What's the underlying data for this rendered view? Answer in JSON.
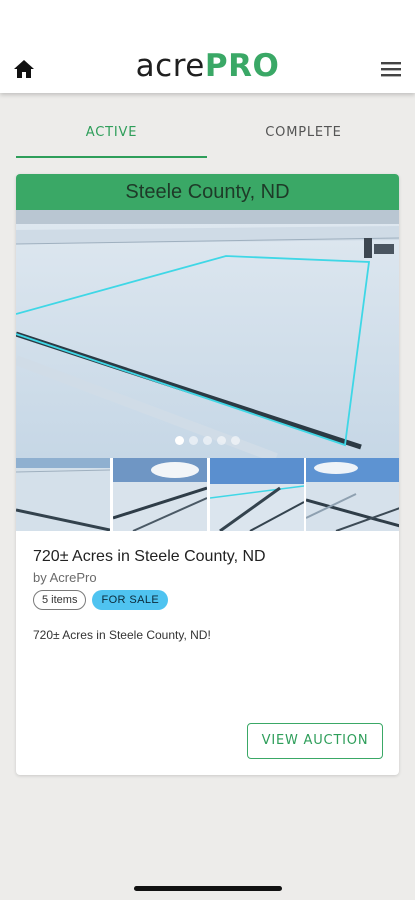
{
  "app": {
    "logo_part1": "acre",
    "logo_part2": "PRO",
    "accent_color": "#3aa866"
  },
  "nav": {
    "home_icon": "home-icon",
    "menu_icon": "hamburger-menu-icon"
  },
  "tabs": [
    {
      "label": "ACTIVE",
      "selected": true
    },
    {
      "label": "COMPLETE",
      "selected": false
    }
  ],
  "listing": {
    "header": "Steele County, ND",
    "title": "720± Acres in Steele County, ND",
    "byline": "by AcrePro",
    "items_chip": "5 items",
    "status_chip": "FOR SALE",
    "description": "720± Acres in Steele County, ND!",
    "button_label": "VIEW AUCTION",
    "carousel": {
      "total_slides": 5,
      "current_slide": 1
    },
    "thumbnails": [
      "thumbnail-1",
      "thumbnail-2",
      "thumbnail-3",
      "thumbnail-4"
    ]
  }
}
